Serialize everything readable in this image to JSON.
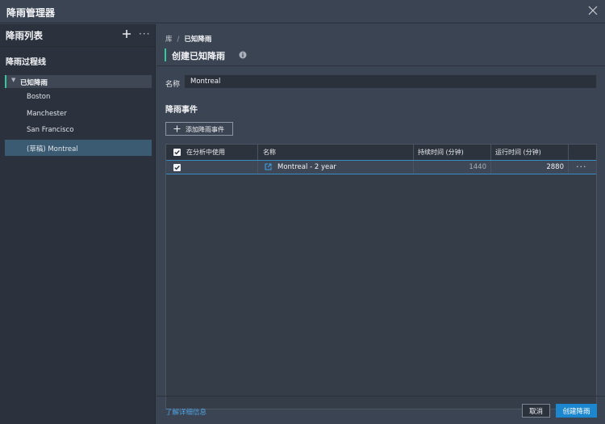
{
  "window": {
    "title": "降雨管理器",
    "close_icon": "close-icon"
  },
  "sidebar": {
    "title": "降雨列表",
    "section_title": "降雨过程线",
    "tree_root": {
      "label": "已知降雨",
      "expanded": true
    },
    "items": [
      {
        "label": "Boston",
        "selected": false
      },
      {
        "label": "Manchester",
        "selected": false
      },
      {
        "label": "San Francisco",
        "selected": false
      },
      {
        "label": "(草稿) Montreal",
        "selected": true
      }
    ]
  },
  "main": {
    "breadcrumb": {
      "root": "库",
      "separator": "/",
      "current": "已知降雨"
    },
    "page_title": "创建已知降雨",
    "name_label": "名称",
    "name_value": "Montreal",
    "events_title": "降雨事件",
    "add_event_label": "添加降雨事件",
    "table": {
      "headers": [
        "在分析中使用",
        "名称",
        "持续时间 (分钟)",
        "运行时间 (分钟)"
      ],
      "rows": [
        {
          "use": true,
          "name": "Montreal - 2 year",
          "duration": "1440",
          "runtime": "2880"
        }
      ]
    },
    "footer": {
      "learn_more": "了解详细信息",
      "cancel": "取消",
      "create": "创建降雨"
    }
  },
  "colors": {
    "accent": "#38c6a0",
    "primary": "#1b87cf",
    "link": "#4ea4e4",
    "selection": "#3a5b72"
  }
}
